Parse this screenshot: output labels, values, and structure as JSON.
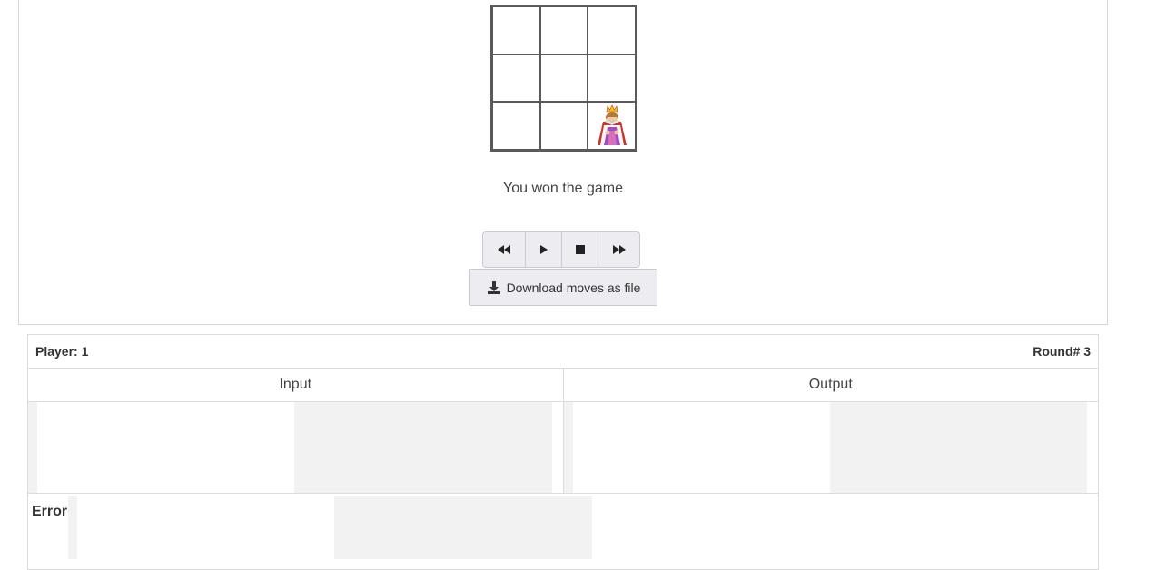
{
  "game": {
    "status_text": "You won the game",
    "board": [
      [
        "",
        "",
        ""
      ],
      [
        "",
        "",
        ""
      ],
      [
        "",
        "",
        "queen"
      ]
    ],
    "queen_icon": "queen-icon"
  },
  "controls": {
    "icons": [
      "rewind-icon",
      "play-icon",
      "stop-icon",
      "fast-forward-icon"
    ]
  },
  "download": {
    "label": "Download moves as file",
    "icon": "download-icon"
  },
  "info": {
    "player_label": "Player: 1",
    "round_label": "Round# 3",
    "input_title": "Input",
    "output_title": "Output",
    "error_label": "Error"
  },
  "colors": {
    "button_bg": "#ececf1",
    "board_border": "#5a5a5a",
    "pane_bg": "#f2f2f2"
  }
}
